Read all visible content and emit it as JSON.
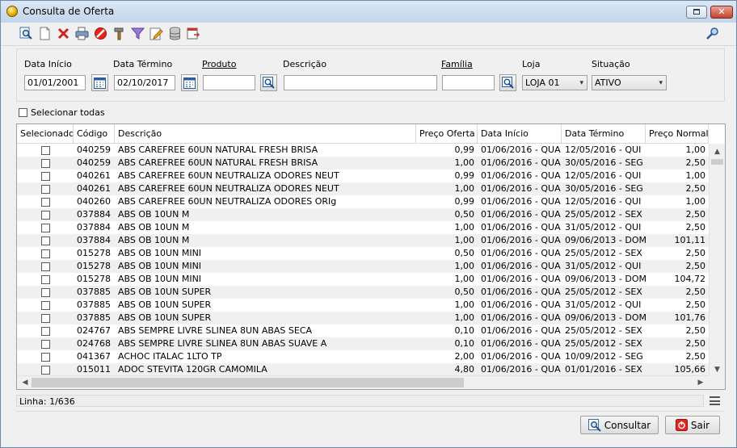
{
  "window": {
    "title": "Consulta de Oferta"
  },
  "filters": {
    "data_inicio_label": "Data Início",
    "data_inicio_value": "01/01/2001",
    "data_termino_label": "Data Término",
    "data_termino_value": "02/10/2017",
    "produto_label": "Produto",
    "produto_value": "",
    "descricao_label": "Descrição",
    "descricao_value": "",
    "familia_label": "Família",
    "familia_value": "",
    "loja_label": "Loja",
    "loja_value": "LOJA 01",
    "situacao_label": "Situação",
    "situacao_value": "ATIVO"
  },
  "select_all_label": "Selecionar todas",
  "grid": {
    "columns": [
      "Selecionado",
      "Código",
      "Descrição",
      "Preço Oferta",
      "Data Início",
      "Data Término",
      "Preço Normal"
    ],
    "rows": [
      [
        "040259",
        "ABS CAREFREE 60UN NATURAL FRESH BRISA",
        "0,99",
        "01/06/2016 - QUA",
        "12/05/2016 - QUI",
        "1,00"
      ],
      [
        "040259",
        "ABS CAREFREE 60UN NATURAL FRESH BRISA",
        "1,00",
        "01/06/2016 - QUA",
        "30/05/2016 - SEG",
        "2,50"
      ],
      [
        "040261",
        "ABS CAREFREE 60UN NEUTRALIZA ODORES NEUT",
        "0,99",
        "01/06/2016 - QUA",
        "12/05/2016 - QUI",
        "1,00"
      ],
      [
        "040261",
        "ABS CAREFREE 60UN NEUTRALIZA ODORES NEUT",
        "1,00",
        "01/06/2016 - QUA",
        "30/05/2016 - SEG",
        "2,50"
      ],
      [
        "040260",
        "ABS CAREFREE 60UN NEUTRALIZA ODORES ORIg",
        "0,99",
        "01/06/2016 - QUA",
        "12/05/2016 - QUI",
        "1,00"
      ],
      [
        "037884",
        "ABS OB 10UN M",
        "0,50",
        "01/06/2016 - QUA",
        "25/05/2012 - SEX",
        "2,50"
      ],
      [
        "037884",
        "ABS OB 10UN M",
        "1,00",
        "01/06/2016 - QUA",
        "31/05/2012 - QUI",
        "2,50"
      ],
      [
        "037884",
        "ABS OB 10UN M",
        "1,00",
        "01/06/2016 - QUA",
        "09/06/2013 - DOM",
        "101,11"
      ],
      [
        "015278",
        "ABS OB 10UN MINI",
        "0,50",
        "01/06/2016 - QUA",
        "25/05/2012 - SEX",
        "2,50"
      ],
      [
        "015278",
        "ABS OB 10UN MINI",
        "1,00",
        "01/06/2016 - QUA",
        "31/05/2012 - QUI",
        "2,50"
      ],
      [
        "015278",
        "ABS OB 10UN MINI",
        "1,00",
        "01/06/2016 - QUA",
        "09/06/2013 - DOM",
        "104,72"
      ],
      [
        "037885",
        "ABS OB 10UN SUPER",
        "0,50",
        "01/06/2016 - QUA",
        "25/05/2012 - SEX",
        "2,50"
      ],
      [
        "037885",
        "ABS OB 10UN SUPER",
        "1,00",
        "01/06/2016 - QUA",
        "31/05/2012 - QUI",
        "2,50"
      ],
      [
        "037885",
        "ABS OB 10UN SUPER",
        "1,00",
        "01/06/2016 - QUA",
        "09/06/2013 - DOM",
        "101,76"
      ],
      [
        "024767",
        "ABS SEMPRE LIVRE SLINEA 8UN ABAS SECA",
        "0,10",
        "01/06/2016 - QUA",
        "25/05/2012 - SEX",
        "2,50"
      ],
      [
        "024768",
        "ABS SEMPRE LIVRE SLINEA 8UN ABAS SUAVE A",
        "0,10",
        "01/06/2016 - QUA",
        "25/05/2012 - SEX",
        "2,50"
      ],
      [
        "041367",
        "ACHOC ITALAC 1LTO TP",
        "2,00",
        "01/06/2016 - QUA",
        "10/09/2012 - SEG",
        "2,50"
      ],
      [
        "015011",
        "ADOC STEVITA 120GR CAMOMILA",
        "4,80",
        "01/06/2016 - QUA",
        "01/01/2016 - SEX",
        "105,66"
      ]
    ]
  },
  "status": {
    "line_text": "Linha: 1/636"
  },
  "buttons": {
    "consultar": "Consultar",
    "sair": "Sair"
  }
}
